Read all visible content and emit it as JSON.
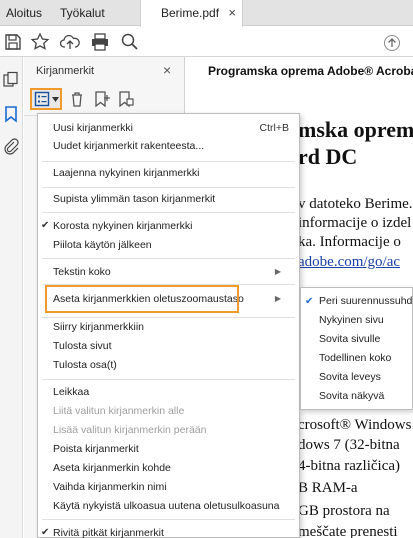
{
  "tabs": {
    "home": "Aloitus",
    "tools": "Työkalut",
    "document": "Berime.pdf",
    "close": "×"
  },
  "toolbar_icons": [
    "save-icon",
    "bookmark-star-icon",
    "upload-icon",
    "print-icon",
    "zoom-icon"
  ],
  "panel": {
    "title": "Kirjanmerkit",
    "close": "×",
    "tools": [
      "options-icon",
      "delete-icon",
      "add-bookmark-icon",
      "bookmark-tag-icon"
    ]
  },
  "document": {
    "header": "Programska oprema Adobe® Acrobat® DC",
    "lines": [
      "mska oprema",
      "rd DC",
      "v datoteko Berime.",
      "informacije o izdel",
      "ka. Informacije o",
      "adobe.com/go/ac",
      "crosoft® Windows",
      "dows 7 (32-bitna",
      "4-bitna različica)",
      "B RAM-a",
      "GB prostora na",
      "meščate prenesti"
    ]
  },
  "menu": {
    "items": [
      {
        "label": "Uusi kirjanmerkki",
        "shortcut": "Ctrl+B"
      },
      {
        "label": "Uudet kirjanmerkit rakenteesta..."
      },
      {
        "label": "Laajenna nykyinen kirjanmerkki"
      },
      {
        "label": "Supista ylimmän tason kirjanmerkit"
      },
      {
        "label": "Korosta nykyinen kirjanmerkki",
        "check": "✔"
      },
      {
        "label": "Piilota käytön jälkeen"
      },
      {
        "label": "Tekstin koko",
        "arrow": "▶"
      },
      {
        "label": "Aseta kirjanmerkkien oletuszoomaustaso",
        "arrow": "▶"
      },
      {
        "label": "Siirry kirjanmerkkiin"
      },
      {
        "label": "Tulosta sivut"
      },
      {
        "label": "Tulosta osa(t)"
      },
      {
        "label": "Leikkaa"
      },
      {
        "label": "Liitä valitun kirjanmerkin alle",
        "disabled": true
      },
      {
        "label": "Lisää valitun kirjanmerkin perään",
        "disabled": true
      },
      {
        "label": "Poista kirjanmerkit"
      },
      {
        "label": "Aseta kirjanmerkin kohde"
      },
      {
        "label": "Vaihda kirjanmerkin nimi"
      },
      {
        "label": "Käytä nykyistä ulkoasua uutena oletusulkoasuna"
      },
      {
        "label": "Rivitä pitkät kirjanmerkit",
        "check": "✔"
      }
    ]
  },
  "submenu": {
    "items": [
      {
        "label": "Peri suurennussuhde",
        "check": "✔"
      },
      {
        "label": "Nykyinen sivu"
      },
      {
        "label": "Sovita sivulle"
      },
      {
        "label": "Todellinen koko"
      },
      {
        "label": "Sovita leveys"
      },
      {
        "label": "Sovita näkyvä"
      }
    ]
  },
  "colors": {
    "highlight": "#f09a2c",
    "rail_bookmark": "#1a6bd0",
    "link": "#1a3fa8"
  }
}
